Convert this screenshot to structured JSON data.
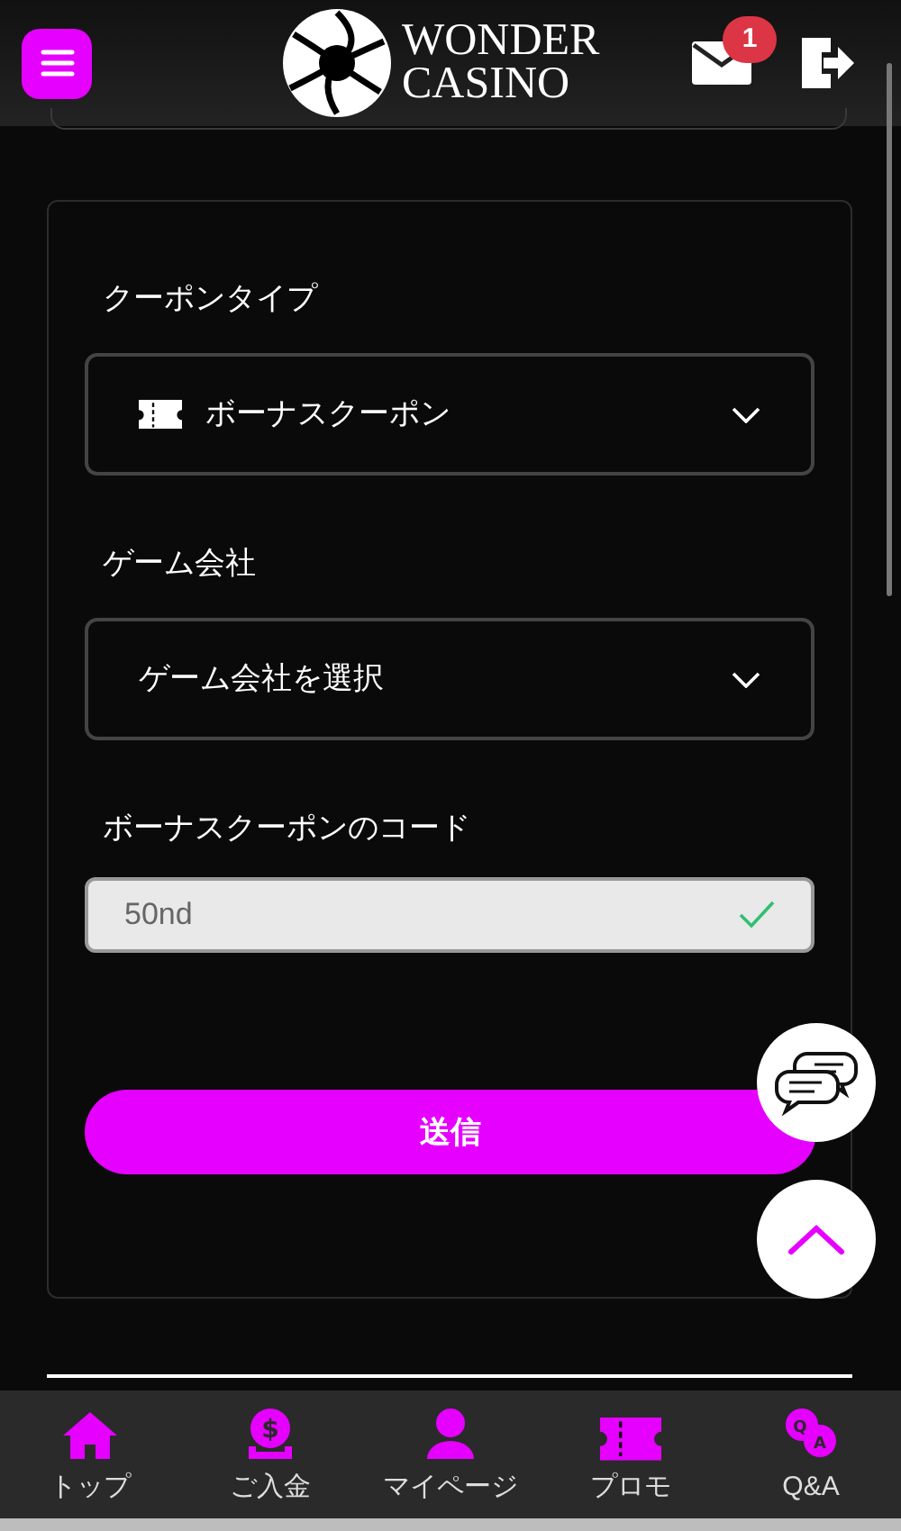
{
  "header": {
    "logo": [
      "WONDER",
      "CASINO"
    ],
    "mail_badge": "1"
  },
  "fields": [
    {
      "kind": "select",
      "label": "クーポンタイプ",
      "value": "ボーナスクーポン"
    },
    {
      "kind": "select",
      "label": "ゲーム会社",
      "value": "ゲーム会社を選択"
    },
    {
      "kind": "input",
      "label": "ボーナスクーポンのコード",
      "value": "50nd",
      "valid": true
    }
  ],
  "submit": "送信",
  "nav": [
    {
      "label": "トップ"
    },
    {
      "label": "ご入金",
      "icon_text": [
        "$"
      ]
    },
    {
      "label": "マイページ"
    },
    {
      "label": "プロモ"
    },
    {
      "label": "Q&A",
      "icon_text": [
        "Q",
        "A"
      ]
    }
  ]
}
